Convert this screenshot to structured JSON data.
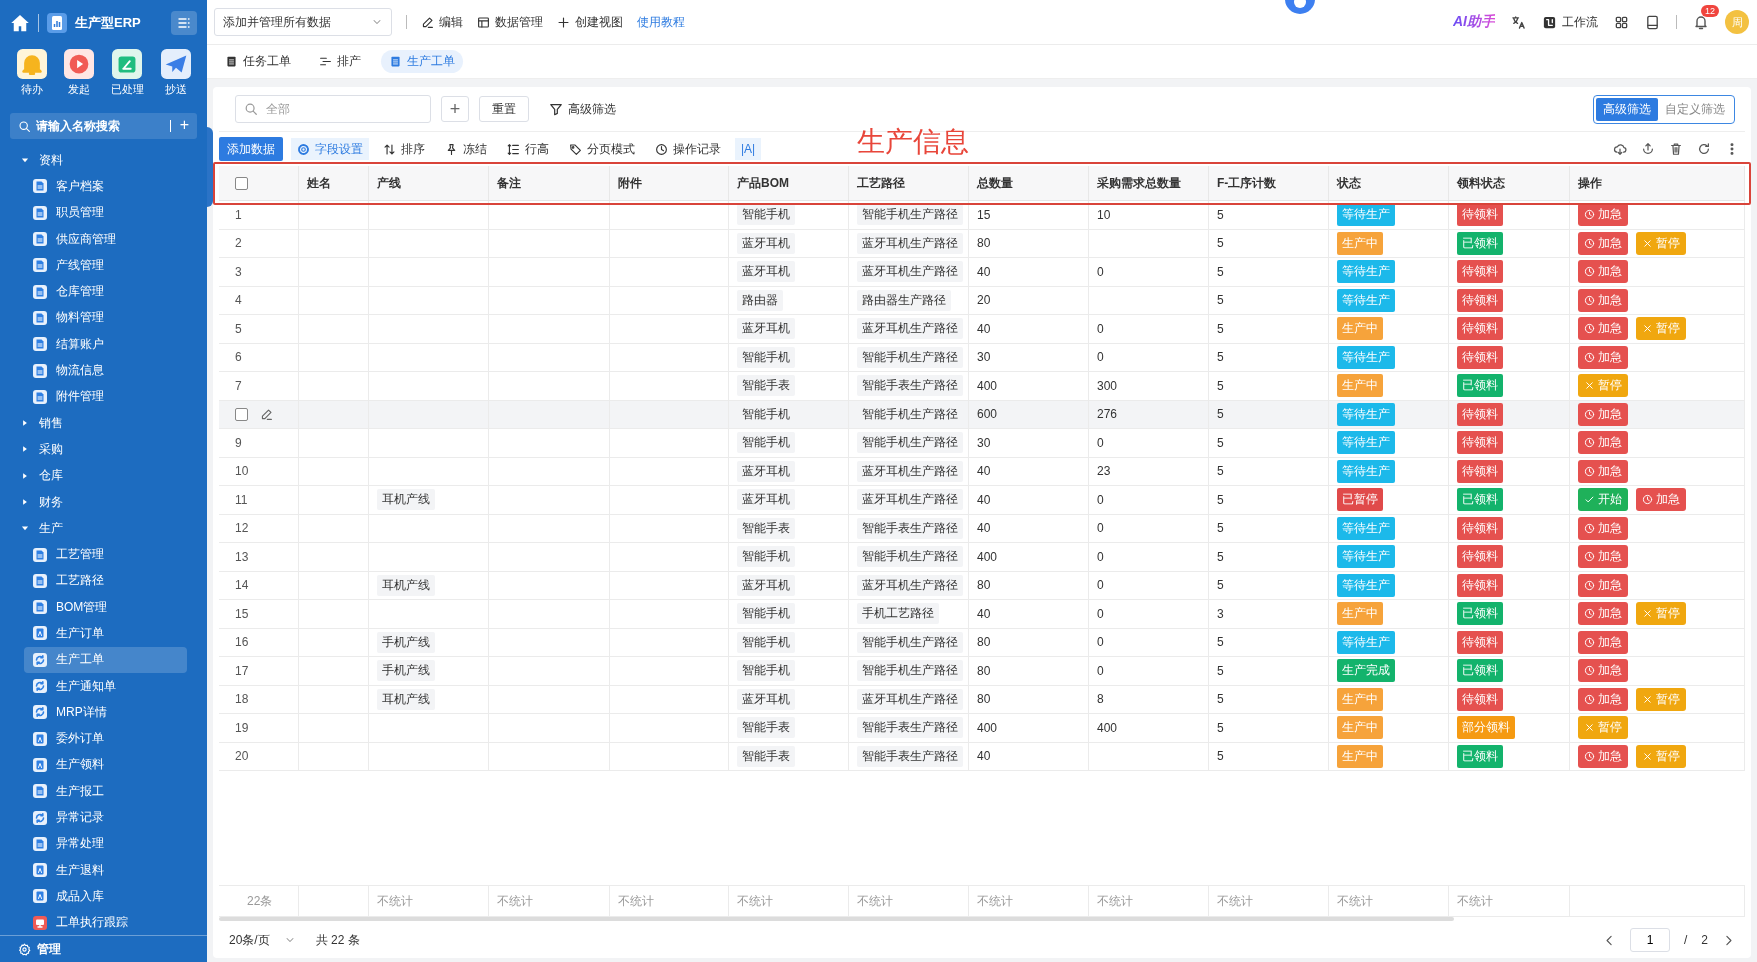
{
  "sidebar": {
    "app_name": "生产型ERP",
    "shortcuts": [
      {
        "label": "待办",
        "kind": "bell"
      },
      {
        "label": "发起",
        "kind": "play"
      },
      {
        "label": "已处理",
        "kind": "inbox"
      },
      {
        "label": "抄送",
        "kind": "send"
      }
    ],
    "search": {
      "placeholder": "请输入名称搜索",
      "add": "+"
    },
    "tree": [
      {
        "label": "资料",
        "expanded": true,
        "children": [
          {
            "label": "客户档案",
            "kind": "doc",
            "selected": false
          },
          {
            "label": "职员管理",
            "kind": "doc",
            "selected": false
          },
          {
            "label": "供应商管理",
            "kind": "doc",
            "selected": false
          },
          {
            "label": "产线管理",
            "kind": "doc",
            "selected": false
          },
          {
            "label": "仓库管理",
            "kind": "doc",
            "selected": false
          },
          {
            "label": "物料管理",
            "kind": "doc",
            "selected": false
          },
          {
            "label": "结算账户",
            "kind": "doc",
            "selected": false
          },
          {
            "label": "物流信息",
            "kind": "doc",
            "selected": false
          },
          {
            "label": "附件管理",
            "kind": "doc",
            "selected": false
          }
        ]
      },
      {
        "label": "销售",
        "expanded": false
      },
      {
        "label": "采购",
        "expanded": false
      },
      {
        "label": "仓库",
        "expanded": false
      },
      {
        "label": "财务",
        "expanded": false
      },
      {
        "label": "生产",
        "expanded": true,
        "children": [
          {
            "label": "工艺管理",
            "kind": "doc",
            "selected": false
          },
          {
            "label": "工艺路径",
            "kind": "doc",
            "selected": false
          },
          {
            "label": "BOM管理",
            "kind": "doc",
            "selected": false
          },
          {
            "label": "生产订单",
            "kind": "form",
            "selected": false
          },
          {
            "label": "生产工单",
            "kind": "sync",
            "selected": true
          },
          {
            "label": "生产通知单",
            "kind": "sync",
            "selected": false
          },
          {
            "label": "MRP详情",
            "kind": "sync",
            "selected": false
          },
          {
            "label": "委外订单",
            "kind": "form",
            "selected": false
          },
          {
            "label": "生产领料",
            "kind": "form",
            "selected": false
          },
          {
            "label": "生产报工",
            "kind": "doc",
            "selected": false
          },
          {
            "label": "异常记录",
            "kind": "sync",
            "selected": false
          },
          {
            "label": "异常处理",
            "kind": "doc",
            "selected": false
          },
          {
            "label": "生产退料",
            "kind": "form",
            "selected": false
          },
          {
            "label": "成品入库",
            "kind": "form",
            "selected": false
          },
          {
            "label": "工单执行跟踪",
            "kind": "alert",
            "selected": false
          }
        ]
      }
    ],
    "footer_item": "管理"
  },
  "topbar": {
    "view_select": "添加并管理所有数据",
    "actions": [
      {
        "label": "编辑",
        "kind": "edit"
      },
      {
        "label": "数据管理",
        "kind": "data"
      },
      {
        "label": "创建视图",
        "kind": "add"
      },
      {
        "label": "使用教程",
        "kind": "link"
      }
    ],
    "ai_label": "AI助手",
    "workflow": "工作流",
    "notification_count": "12",
    "avatar": "周"
  },
  "tabs": [
    {
      "label": "任务工单",
      "kind": "doc",
      "selected": false
    },
    {
      "label": "排产",
      "kind": "gantt",
      "selected": false
    },
    {
      "label": "生产工单",
      "kind": "doc",
      "selected": true
    }
  ],
  "filter": {
    "search_placeholder": "全部",
    "add": "+",
    "reset": "重置",
    "advanced": "高级筛选",
    "modes": [
      {
        "label": "高级筛选",
        "selected": true
      },
      {
        "label": "自定义筛选",
        "selected": false
      }
    ]
  },
  "toolbar": [
    {
      "label": "添加数据",
      "kind": "primary"
    },
    {
      "label": "字段设置",
      "kind": "settings"
    },
    {
      "label": "排序",
      "kind": "sort"
    },
    {
      "label": "冻结",
      "kind": "pin"
    },
    {
      "label": "行高",
      "kind": "height"
    },
    {
      "label": "分页模式",
      "kind": "tag"
    },
    {
      "label": "操作记录",
      "kind": "history"
    },
    {
      "label": "|A|",
      "kind": "text"
    }
  ],
  "annotation": {
    "label": "生产信息"
  },
  "table": {
    "select_all": {
      "checked": false
    },
    "columns": [
      "姓名",
      "产线",
      "备注",
      "附件",
      "产品BOM",
      "工艺路径",
      "总数量",
      "采购需求总数量",
      "F-工序计数",
      "状态",
      "领料状态",
      "操作"
    ],
    "rows": [
      {
        "number": "1",
        "hovered": false,
        "bom": "智能手机",
        "route": "智能手机生产路径",
        "total": "15",
        "purchase": "10",
        "steps": "5",
        "status": {
          "label": "等待生产",
          "color": "#1cb9ea"
        },
        "pick": {
          "label": "待领料",
          "color": "#e5514f"
        },
        "actions": [
          {
            "label": "加急",
            "kind": "urgent"
          }
        ]
      },
      {
        "number": "2",
        "hovered": false,
        "bom": "蓝牙耳机",
        "route": "蓝牙耳机生产路径",
        "total": "80",
        "steps": "5",
        "status": {
          "label": "生产中",
          "color": "#f6a33b"
        },
        "pick": {
          "label": "已领料",
          "color": "#13b36c"
        },
        "actions": [
          {
            "label": "加急",
            "kind": "urgent"
          },
          {
            "label": "暂停",
            "kind": "pause"
          }
        ]
      },
      {
        "number": "3",
        "hovered": false,
        "bom": "蓝牙耳机",
        "route": "蓝牙耳机生产路径",
        "total": "40",
        "purchase": "0",
        "steps": "5",
        "status": {
          "label": "等待生产",
          "color": "#1cb9ea"
        },
        "pick": {
          "label": "待领料",
          "color": "#e5514f"
        },
        "actions": [
          {
            "label": "加急",
            "kind": "urgent"
          }
        ]
      },
      {
        "number": "4",
        "hovered": false,
        "bom": "路由器",
        "route": "路由器生产路径",
        "total": "20",
        "steps": "5",
        "status": {
          "label": "等待生产",
          "color": "#1cb9ea"
        },
        "pick": {
          "label": "待领料",
          "color": "#e5514f"
        },
        "actions": [
          {
            "label": "加急",
            "kind": "urgent"
          }
        ]
      },
      {
        "number": "5",
        "hovered": false,
        "bom": "蓝牙耳机",
        "route": "蓝牙耳机生产路径",
        "total": "40",
        "purchase": "0",
        "steps": "5",
        "status": {
          "label": "生产中",
          "color": "#f6a33b"
        },
        "pick": {
          "label": "待领料",
          "color": "#e5514f"
        },
        "actions": [
          {
            "label": "加急",
            "kind": "urgent"
          },
          {
            "label": "暂停",
            "kind": "pause"
          }
        ]
      },
      {
        "number": "6",
        "hovered": false,
        "bom": "智能手机",
        "route": "智能手机生产路径",
        "total": "30",
        "purchase": "0",
        "steps": "5",
        "status": {
          "label": "等待生产",
          "color": "#1cb9ea"
        },
        "pick": {
          "label": "待领料",
          "color": "#e5514f"
        },
        "actions": [
          {
            "label": "加急",
            "kind": "urgent"
          }
        ]
      },
      {
        "number": "7",
        "hovered": false,
        "bom": "智能手表",
        "route": "智能手表生产路径",
        "total": "400",
        "purchase": "300",
        "steps": "5",
        "status": {
          "label": "生产中",
          "color": "#f6a33b"
        },
        "pick": {
          "label": "已领料",
          "color": "#13b36c"
        },
        "actions": [
          {
            "label": "暂停",
            "kind": "pause"
          }
        ]
      },
      {
        "hovered": true,
        "checked": false,
        "bom": "智能手机",
        "route": "智能手机生产路径",
        "total": "600",
        "purchase": "276",
        "steps": "5",
        "status": {
          "label": "等待生产",
          "color": "#1cb9ea"
        },
        "pick": {
          "label": "待领料",
          "color": "#e5514f"
        },
        "actions": [
          {
            "label": "加急",
            "kind": "urgent"
          }
        ]
      },
      {
        "number": "9",
        "hovered": false,
        "bom": "智能手机",
        "route": "智能手机生产路径",
        "total": "30",
        "purchase": "0",
        "steps": "5",
        "status": {
          "label": "等待生产",
          "color": "#1cb9ea"
        },
        "pick": {
          "label": "待领料",
          "color": "#e5514f"
        },
        "actions": [
          {
            "label": "加急",
            "kind": "urgent"
          }
        ]
      },
      {
        "number": "10",
        "hovered": false,
        "bom": "蓝牙耳机",
        "route": "蓝牙耳机生产路径",
        "total": "40",
        "purchase": "23",
        "steps": "5",
        "status": {
          "label": "等待生产",
          "color": "#1cb9ea"
        },
        "pick": {
          "label": "待领料",
          "color": "#e5514f"
        },
        "actions": [
          {
            "label": "加急",
            "kind": "urgent"
          }
        ]
      },
      {
        "number": "11",
        "hovered": false,
        "line": "耳机产线",
        "bom": "蓝牙耳机",
        "route": "蓝牙耳机生产路径",
        "total": "40",
        "purchase": "0",
        "steps": "5",
        "status": {
          "label": "已暂停",
          "color": "#e04a4a"
        },
        "pick": {
          "label": "已领料",
          "color": "#13b36c"
        },
        "actions": [
          {
            "label": "开始",
            "kind": "start"
          },
          {
            "label": "加急",
            "kind": "urgent"
          }
        ]
      },
      {
        "number": "12",
        "hovered": false,
        "bom": "智能手表",
        "route": "智能手表生产路径",
        "total": "40",
        "purchase": "0",
        "steps": "5",
        "status": {
          "label": "等待生产",
          "color": "#1cb9ea"
        },
        "pick": {
          "label": "待领料",
          "color": "#e5514f"
        },
        "actions": [
          {
            "label": "加急",
            "kind": "urgent"
          }
        ]
      },
      {
        "number": "13",
        "hovered": false,
        "bom": "智能手机",
        "route": "智能手机生产路径",
        "total": "400",
        "purchase": "0",
        "steps": "5",
        "status": {
          "label": "等待生产",
          "color": "#1cb9ea"
        },
        "pick": {
          "label": "待领料",
          "color": "#e5514f"
        },
        "actions": [
          {
            "label": "加急",
            "kind": "urgent"
          }
        ]
      },
      {
        "number": "14",
        "hovered": false,
        "line": "耳机产线",
        "bom": "蓝牙耳机",
        "route": "蓝牙耳机生产路径",
        "total": "80",
        "purchase": "0",
        "steps": "5",
        "status": {
          "label": "等待生产",
          "color": "#1cb9ea"
        },
        "pick": {
          "label": "待领料",
          "color": "#e5514f"
        },
        "actions": [
          {
            "label": "加急",
            "kind": "urgent"
          }
        ]
      },
      {
        "number": "15",
        "hovered": false,
        "bom": "智能手机",
        "route": "手机工艺路径",
        "total": "40",
        "purchase": "0",
        "steps": "3",
        "status": {
          "label": "生产中",
          "color": "#f6a33b"
        },
        "pick": {
          "label": "已领料",
          "color": "#13b36c"
        },
        "actions": [
          {
            "label": "加急",
            "kind": "urgent"
          },
          {
            "label": "暂停",
            "kind": "pause"
          }
        ]
      },
      {
        "number": "16",
        "hovered": false,
        "line": "手机产线",
        "bom": "智能手机",
        "route": "智能手机生产路径",
        "total": "80",
        "purchase": "0",
        "steps": "5",
        "status": {
          "label": "等待生产",
          "color": "#1cb9ea"
        },
        "pick": {
          "label": "待领料",
          "color": "#e5514f"
        },
        "actions": [
          {
            "label": "加急",
            "kind": "urgent"
          }
        ]
      },
      {
        "number": "17",
        "hovered": false,
        "line": "手机产线",
        "bom": "智能手机",
        "route": "智能手机生产路径",
        "total": "80",
        "purchase": "0",
        "steps": "5",
        "status": {
          "label": "生产完成",
          "color": "#13b36c"
        },
        "pick": {
          "label": "已领料",
          "color": "#13b36c"
        },
        "actions": [
          {
            "label": "加急",
            "kind": "urgent"
          }
        ]
      },
      {
        "number": "18",
        "hovered": false,
        "line": "耳机产线",
        "bom": "蓝牙耳机",
        "route": "蓝牙耳机生产路径",
        "total": "80",
        "purchase": "8",
        "steps": "5",
        "status": {
          "label": "生产中",
          "color": "#f6a33b"
        },
        "pick": {
          "label": "待领料",
          "color": "#e5514f"
        },
        "actions": [
          {
            "label": "加急",
            "kind": "urgent"
          },
          {
            "label": "暂停",
            "kind": "pause"
          }
        ]
      },
      {
        "number": "19",
        "hovered": false,
        "bom": "智能手表",
        "route": "智能手表生产路径",
        "total": "400",
        "purchase": "400",
        "steps": "5",
        "status": {
          "label": "生产中",
          "color": "#f6a33b"
        },
        "pick": {
          "label": "部分领料",
          "color": "#f59a12"
        },
        "actions": [
          {
            "label": "暂停",
            "kind": "pause"
          }
        ]
      },
      {
        "number": "20",
        "hovered": false,
        "bom": "智能手表",
        "route": "智能手表生产路径",
        "total": "40",
        "steps": "5",
        "status": {
          "label": "生产中",
          "color": "#f6a33b"
        },
        "pick": {
          "label": "已领料",
          "color": "#13b36c"
        },
        "actions": [
          {
            "label": "加急",
            "kind": "urgent"
          },
          {
            "label": "暂停",
            "kind": "pause"
          }
        ]
      }
    ],
    "summary": {
      "count": "22条",
      "stats": [
        "不统计",
        "不统计",
        "不统计",
        "不统计",
        "不统计",
        "不统计",
        "不统计",
        "不统计",
        "不统计",
        "不统计"
      ]
    }
  },
  "pagination": {
    "page_size": "20条/页",
    "total": "共 22 条",
    "page": "1",
    "separator": "/",
    "pages": "2"
  }
}
